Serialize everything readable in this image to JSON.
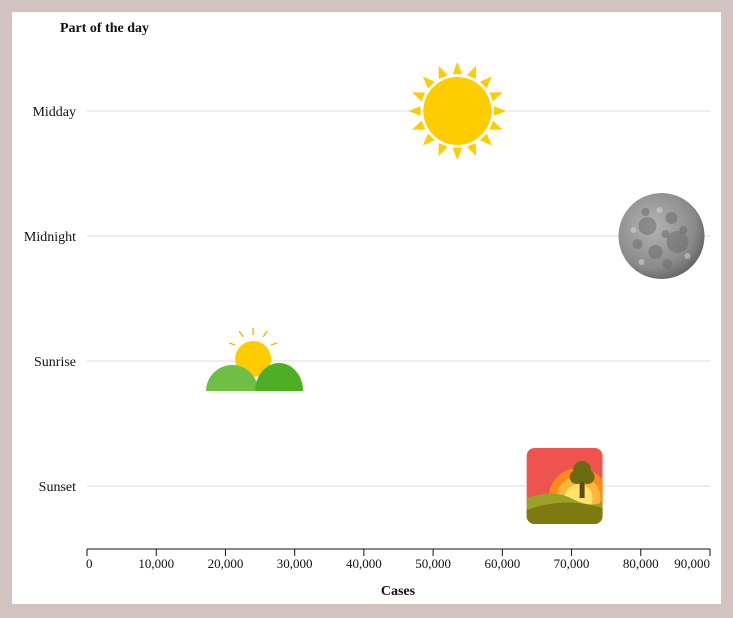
{
  "chart_data": {
    "type": "scatter",
    "title": "",
    "ylabel": "Part of the day",
    "xlabel": "Cases",
    "xlim": [
      0,
      90000
    ],
    "x_ticks": [
      "0",
      "10,000",
      "20,000",
      "30,000",
      "40,000",
      "50,000",
      "60,000",
      "70,000",
      "80,000",
      "90,000"
    ],
    "x_tick_values": [
      0,
      10000,
      20000,
      30000,
      40000,
      50000,
      60000,
      70000,
      80000,
      90000
    ],
    "categories": [
      "Midday",
      "Midnight",
      "Sunrise",
      "Sunset"
    ],
    "grid": "horizontal",
    "points": [
      {
        "category": "Midday",
        "x": 53500,
        "icon": "sun-icon"
      },
      {
        "category": "Midnight",
        "x": 83000,
        "icon": "moon-icon"
      },
      {
        "category": "Sunrise",
        "x": 24000,
        "icon": "sunrise-icon"
      },
      {
        "category": "Sunset",
        "x": 69000,
        "icon": "sunset-icon"
      }
    ]
  },
  "colors": {
    "frame_border": "#d2c3c1",
    "background": "#ffffff",
    "grid": "#e2e2e2",
    "sun": "#ffcc00",
    "hill_light": "#6fbe46",
    "hill_dark": "#4caf25",
    "sunset_bg": "#ee5350",
    "moon": "#8a8a8a"
  }
}
